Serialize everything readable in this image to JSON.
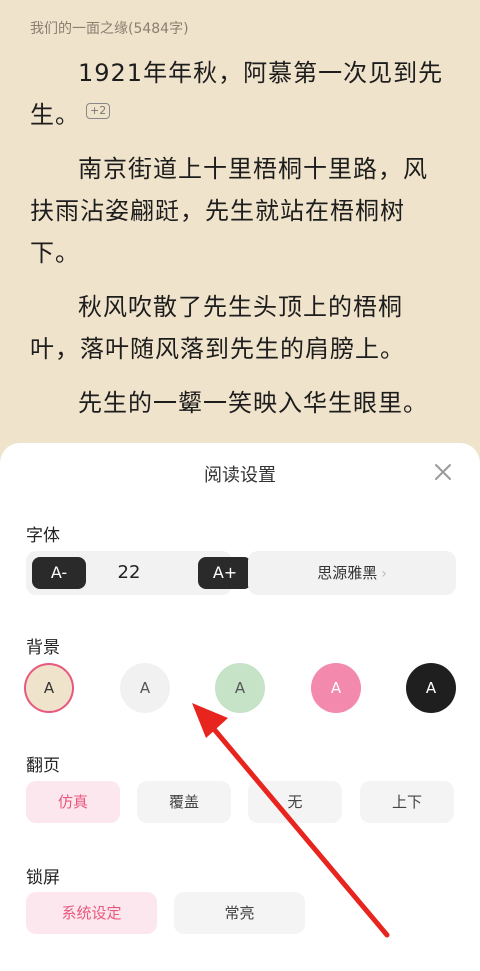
{
  "reader": {
    "chapter_title": "我们的一面之缘(5484字)",
    "paragraphs": [
      "1921年年秋，阿慕第一次见到先生。",
      "南京街道上十里梧桐十里路，风扶雨沾姿翩跹，先生就站在梧桐树下。",
      "秋风吹散了先生头顶上的梧桐叶，落叶随风落到先生的肩膀上。",
      "先生的一颦一笑映入华生眼里。"
    ],
    "comment_badge": "+2"
  },
  "settings": {
    "title": "阅读设置",
    "font": {
      "label": "字体",
      "decrease_label": "A-",
      "size_value": "22",
      "increase_label": "A+",
      "family_name": "思源雅黑",
      "chevron": "›"
    },
    "background": {
      "label": "背景",
      "swatches": [
        {
          "letter": "A",
          "color": "#efe3cb",
          "text_color": "#333333",
          "selected": true
        },
        {
          "letter": "A",
          "color": "#f1f1f1",
          "text_color": "#555555",
          "selected": false
        },
        {
          "letter": "A",
          "color": "#c6e2c7",
          "text_color": "#555555",
          "selected": false
        },
        {
          "letter": "A",
          "color": "#f38aae",
          "text_color": "#ffffff",
          "selected": false
        },
        {
          "letter": "A",
          "color": "#1f1f1f",
          "text_color": "#ffffff",
          "selected": false
        }
      ]
    },
    "page_turn": {
      "label": "翻页",
      "options": [
        "仿真",
        "覆盖",
        "无",
        "上下"
      ],
      "selected_index": 0
    },
    "lock_screen": {
      "label": "锁屏",
      "options": [
        "系统设定",
        "常亮"
      ],
      "selected_index": 0
    }
  },
  "colors": {
    "reader_bg": "#f0e3cc",
    "accent_pink": "#e8587f",
    "annotation_arrow": "#e8241e"
  },
  "icons": {
    "close": "close-icon",
    "chevron": "chevron-right-icon"
  }
}
